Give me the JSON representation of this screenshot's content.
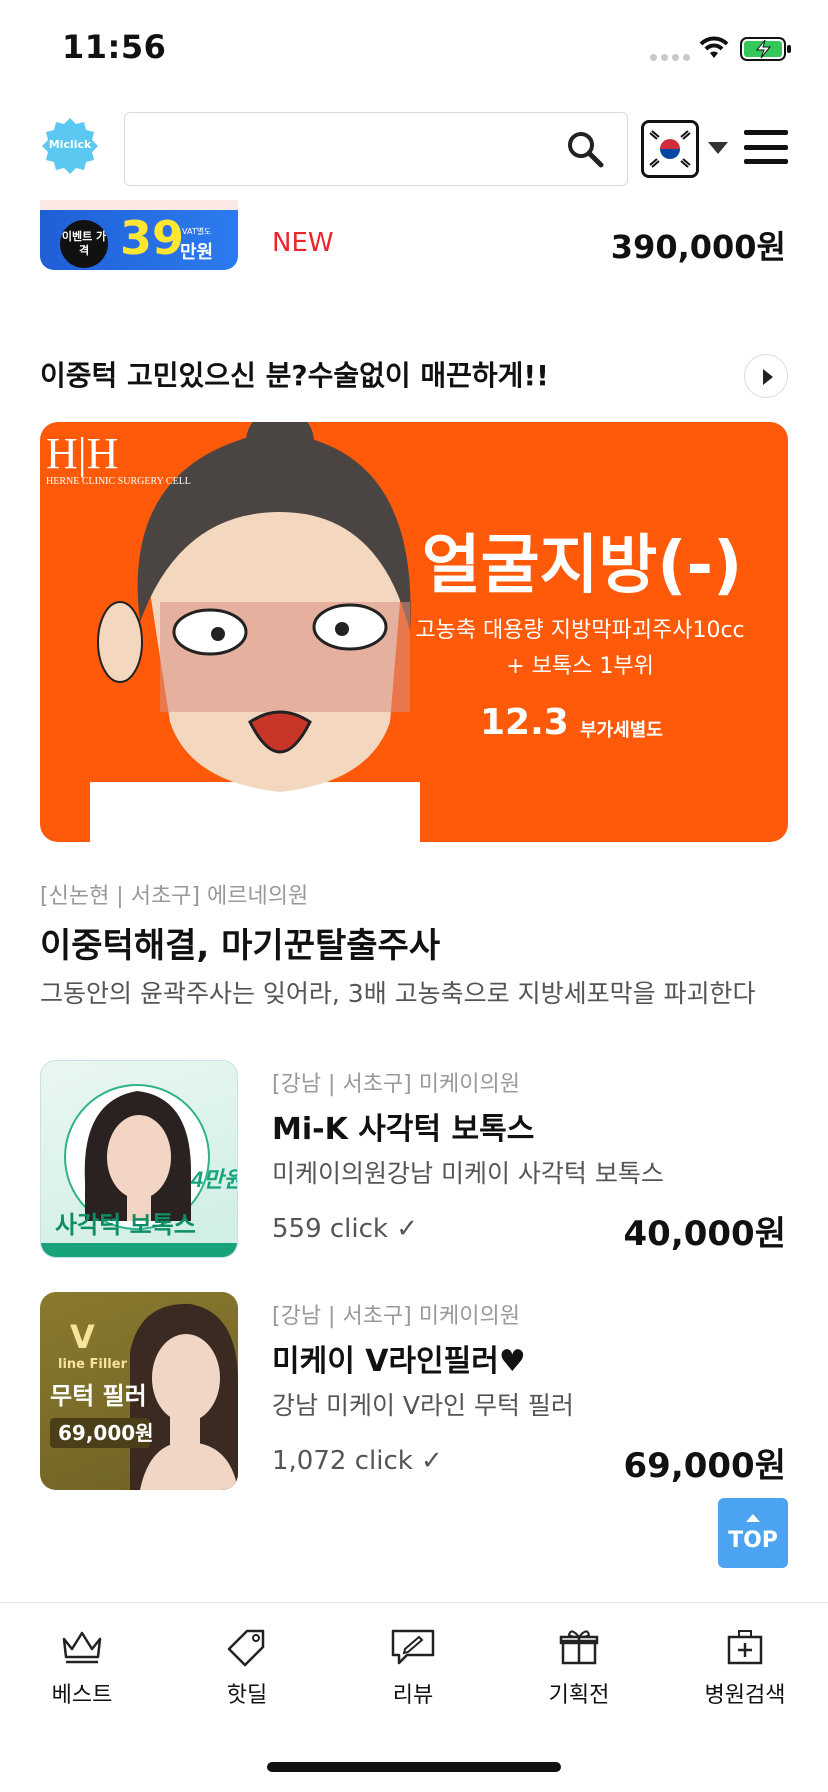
{
  "status_bar": {
    "time": "11:56"
  },
  "header": {
    "logo_text": "Miclick",
    "search_placeholder": "",
    "country_flag": "kr-flag-icon"
  },
  "prev_item": {
    "thumb_badge": "이벤트 가격",
    "thumb_price": "39",
    "thumb_unit": "만원",
    "thumb_vat": "VAT별도",
    "badge": "NEW",
    "price": "390,000원"
  },
  "section": {
    "title": "이중턱 고민있으신 분?수술없이 매끈하게!!"
  },
  "banner": {
    "logo": "H|H",
    "logo_sub": "HERNE CLINIC SURGERY CELL",
    "headline": "얼굴지방(-)",
    "line1": "고농축 대용량 지방막파괴주사10cc",
    "line2": "+ 보톡스 1부위",
    "price": "12.3",
    "vat": "부가세별도"
  },
  "featured": {
    "location": "[신논현 | 서초구] 에르네의원",
    "title": "이중턱해결, 마기꾼탈출주사",
    "description": "그동안의 윤곽주사는 잊어라, 3배 고농축으로 지방세포막을 파괴한다"
  },
  "items": [
    {
      "location": "[강남 | 서초구] 미케이의원",
      "title": "Mi-K 사각턱 보톡스",
      "subtitle": "미케이의원강남 미케이 사각턱 보톡스",
      "clicks": "559  click ✓",
      "price": "40,000원",
      "thumb_text": "사각턱 보톡스",
      "thumb_badge": "4만원"
    },
    {
      "location": "[강남 | 서초구] 미케이의원",
      "title": "미케이 V라인필러♥",
      "subtitle": "강남 미케이 V라인 무턱 필러",
      "clicks": "1,072  click ✓",
      "price": "69,000원",
      "thumb_text": "무턱 필러",
      "thumb_badge": "69,000원",
      "thumb_head": "V",
      "thumb_head_sub": "line Filler"
    }
  ],
  "top_button": {
    "label": "TOP"
  },
  "tabbar": {
    "tabs": [
      {
        "label": "베스트",
        "icon": "crown-icon"
      },
      {
        "label": "핫딜",
        "icon": "tag-icon"
      },
      {
        "label": "리뷰",
        "icon": "review-icon"
      },
      {
        "label": "기획전",
        "icon": "gift-icon"
      },
      {
        "label": "병원검색",
        "icon": "hospital-icon"
      }
    ]
  },
  "colors": {
    "accent_red": "#e8262b",
    "banner_orange": "#ff5a0a",
    "top_button_blue": "#4ba3f2"
  }
}
